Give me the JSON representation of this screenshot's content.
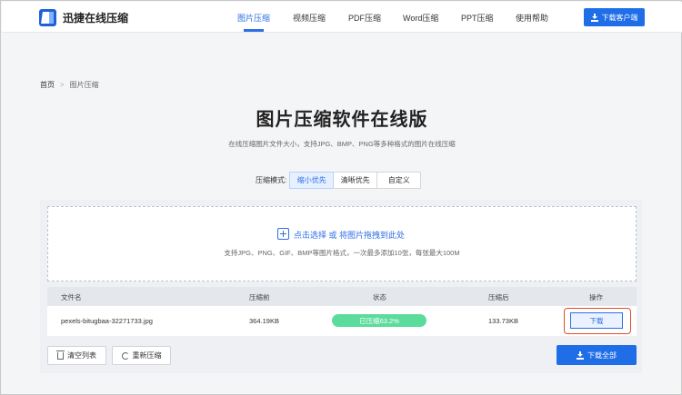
{
  "header": {
    "logo_text": "迅捷在线压缩",
    "nav": [
      "图片压缩",
      "视频压缩",
      "PDF压缩",
      "Word压缩",
      "PPT压缩",
      "使用帮助"
    ],
    "active_nav": "图片压缩",
    "download_client": "下载客户端"
  },
  "breadcrumb": {
    "home": "首页",
    "separator": ">",
    "current": "图片压缩"
  },
  "page": {
    "title": "图片压缩软件在线版",
    "subtitle": "在线压缩图片文件大小，支持JPG、BMP、PNG等多种格式的图片在线压缩"
  },
  "mode": {
    "label": "压缩模式:",
    "options": [
      "缩小优先",
      "清晰优先",
      "自定义"
    ],
    "selected": "缩小优先"
  },
  "upload": {
    "text": "点击选择 或 将图片拖拽到此处",
    "hint": "支持JPG、PNG、GIF、BMP等图片格式，一次最多添加10张，每张最大100M"
  },
  "table": {
    "headers": [
      "文件名",
      "压缩前",
      "状态",
      "压缩后",
      "操作"
    ],
    "rows": [
      {
        "filename": "pexels-bitugbaa-32271733.jpg",
        "before": "364.19KB",
        "status": "已压缩63.2%",
        "after": "133.73KB",
        "action": "下载"
      }
    ]
  },
  "bottom": {
    "clear": "清空列表",
    "recompress": "重新压缩",
    "download_all": "下载全部"
  },
  "colors": {
    "primary": "#1f6ee8",
    "accent": "#2f6fe5",
    "success": "#5bdc9c",
    "highlight": "#e54a2b"
  }
}
